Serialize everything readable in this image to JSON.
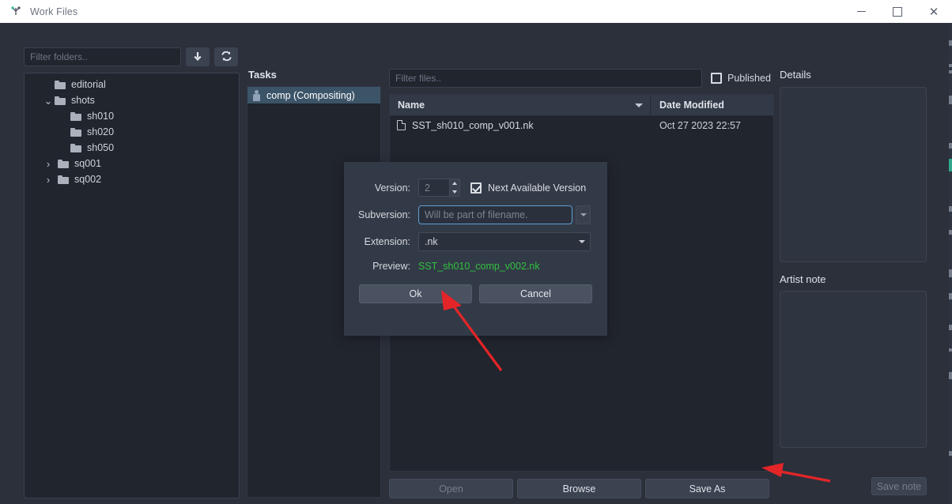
{
  "window": {
    "title": "Work Files",
    "app_icon": "app-logo-icon",
    "minimize_label": "",
    "maximize_label": "",
    "close_label": "✕"
  },
  "folders": {
    "filter_placeholder": "Filter folders..",
    "filter_value": "",
    "download_button_label": "",
    "refresh_button_label": "",
    "tree": [
      {
        "label": "editorial",
        "indent": 1,
        "twisty": "",
        "expanded": false
      },
      {
        "label": "shots",
        "indent": 1,
        "twisty": "⌄",
        "expanded": true
      },
      {
        "label": "sh010",
        "indent": 2,
        "twisty": "",
        "expanded": false
      },
      {
        "label": "sh020",
        "indent": 2,
        "twisty": "",
        "expanded": false
      },
      {
        "label": "sh050",
        "indent": 2,
        "twisty": "",
        "expanded": false
      },
      {
        "label": "sq001",
        "indent": 2,
        "twisty": "›",
        "expanded": false
      },
      {
        "label": "sq002",
        "indent": 2,
        "twisty": "›",
        "expanded": false
      }
    ]
  },
  "tasks": {
    "title": "Tasks",
    "items": [
      {
        "label": "comp (Compositing)",
        "selected": true
      }
    ]
  },
  "files": {
    "filter_placeholder": "Filter files..",
    "filter_value": "",
    "published_label": "Published",
    "published_checked": false,
    "columns": [
      "Name",
      "Date Modified"
    ],
    "sort_column": "Name",
    "rows": [
      {
        "name": "SST_sh010_comp_v001.nk",
        "date_modified": "Oct 27 2023 22:57"
      }
    ],
    "buttons": [
      {
        "label": "Open",
        "enabled": false
      },
      {
        "label": "Browse",
        "enabled": true
      },
      {
        "label": "Save As",
        "enabled": true
      }
    ]
  },
  "details": {
    "title": "Details",
    "content": "",
    "note_title": "Artist note",
    "note_content": "",
    "save_note_label": "Save note",
    "save_note_enabled": false
  },
  "dialog": {
    "version_label": "Version:",
    "version_value": "2",
    "next_available_label": "Next Available Version",
    "next_available_checked": true,
    "subversion_label": "Subversion:",
    "subversion_value": "",
    "subversion_placeholder": "Will be part of filename.",
    "extension_label": "Extension:",
    "extension_value": ".nk",
    "preview_label": "Preview:",
    "preview_value": "SST_sh010_comp_v002.nk",
    "ok_label": "Ok",
    "cancel_label": "Cancel"
  },
  "colors": {
    "window_bg": "#2b303b",
    "panel_bg": "#21252e",
    "titlebar_bg": "#ffffff",
    "selection_blue": "#3c5468",
    "preview_green": "#2fc13f",
    "focus_border": "#5e9fd4",
    "arrow_red": "#e32528",
    "accent_teal": "#2fa98a"
  },
  "annotations": [
    {
      "name": "arrow-pointing-ok-button"
    },
    {
      "name": "arrow-pointing-save-as-button"
    }
  ]
}
